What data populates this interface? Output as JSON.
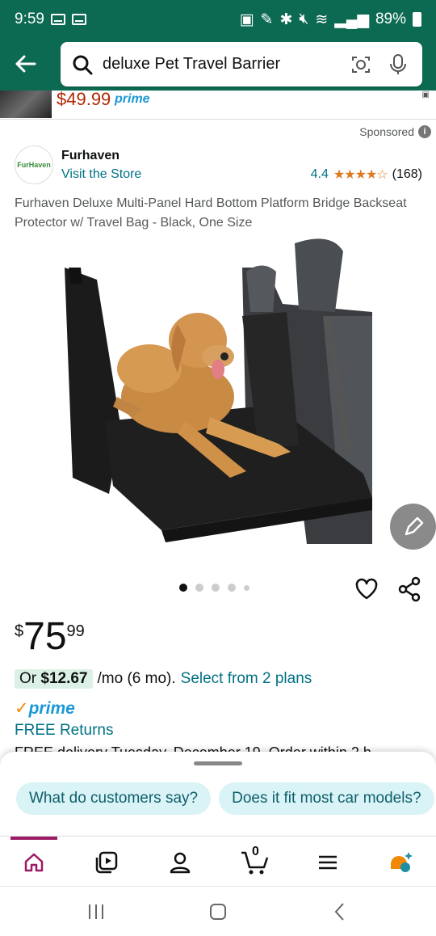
{
  "status_bar": {
    "time": "9:59",
    "battery": "89%"
  },
  "search": {
    "query": "deluxe Pet Travel Barrier"
  },
  "previous_result": {
    "price": "$49.99",
    "prime_label": "prime"
  },
  "ad": {
    "sponsored_label": "Sponsored",
    "brand_logo_text": "FurHaven",
    "brand_name": "Furhaven",
    "visit_store": "Visit the Store",
    "rating": "4.4",
    "stars": "★★★★☆",
    "review_count": "(168)"
  },
  "product": {
    "title": "Furhaven Deluxe Multi-Panel Hard Bottom Platform Bridge Backseat Protector w/ Travel Bag - Black, One Size",
    "price_currency": "$",
    "price_whole": "75",
    "price_fraction": "99",
    "monthly_prefix": "Or",
    "monthly_amount": "$12.67",
    "monthly_suffix": "/mo (6 mo).",
    "monthly_plans_link": "Select from 2 plans",
    "prime_label": "prime",
    "free_returns": "FREE Returns",
    "free_delivery": "FREE delivery Tuesday, December 19. Order within 2 h"
  },
  "image_carousel": {
    "dot_count": 5,
    "active_index": 0
  },
  "suggestion_chips": [
    "What do customers say?",
    "Does it fit most car models?"
  ],
  "bottom_nav": {
    "cart_count": "0",
    "items": [
      "home-icon",
      "video-icon",
      "account-icon",
      "cart-icon",
      "menu-icon",
      "rufus-icon"
    ]
  },
  "colors": {
    "header_green": "#0d6a52",
    "link_teal": "#007185",
    "price_red": "#b12704",
    "prime_blue": "#1a98d5",
    "star_orange": "#de7921",
    "active_nav": "#9c1a66"
  }
}
